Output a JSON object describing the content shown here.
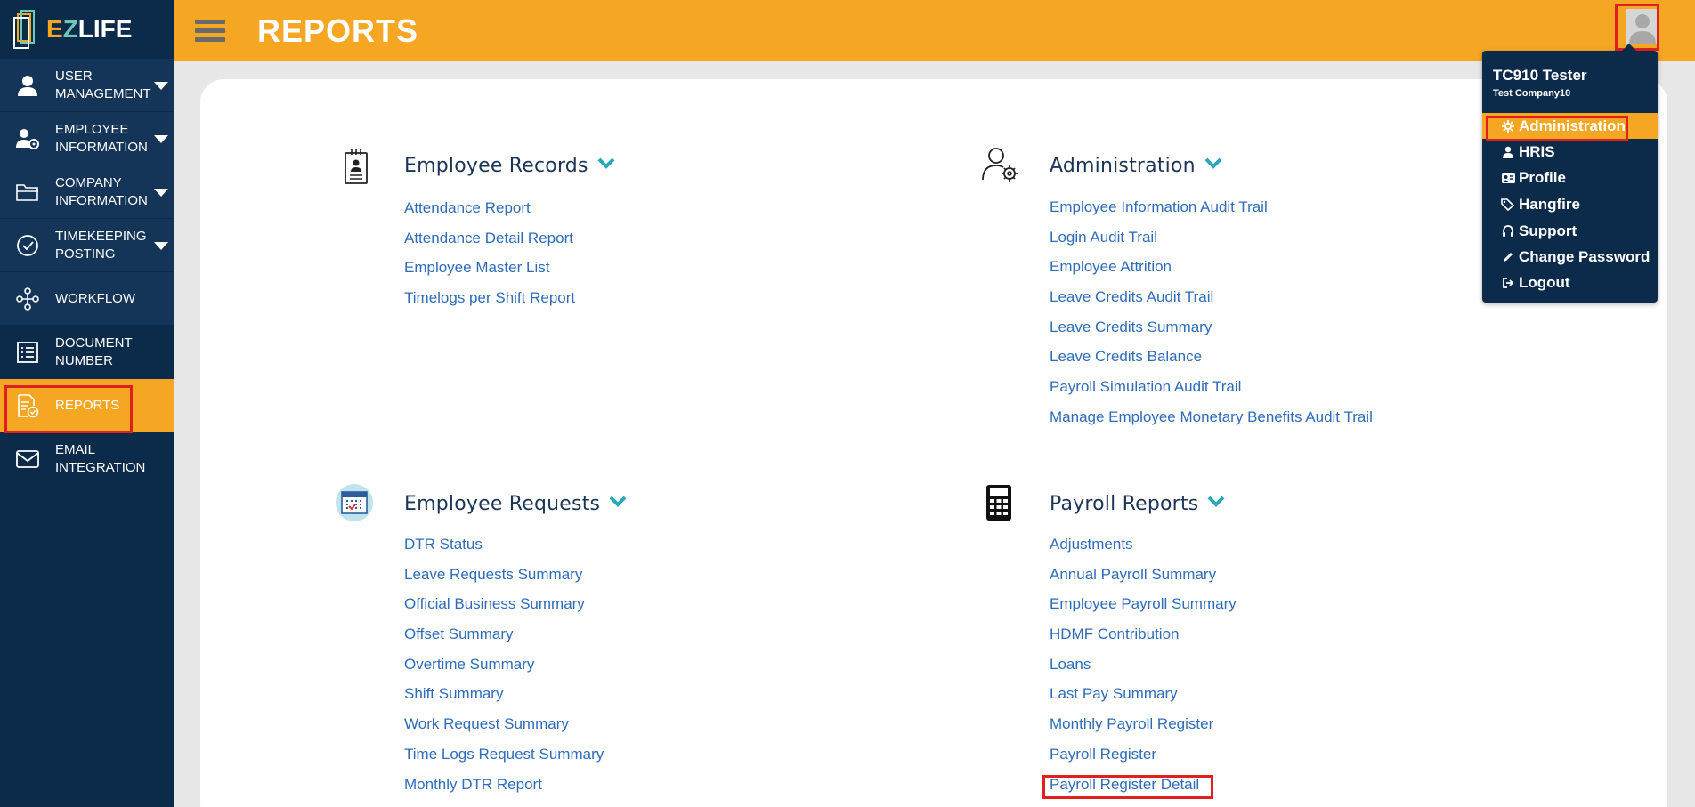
{
  "app": {
    "logo": {
      "e": "E",
      "z": "Z",
      "rest": "LIFE"
    },
    "page_title": "REPORTS"
  },
  "sidebar": {
    "items": [
      {
        "label_line1": "USER",
        "label_line2": "MANAGEMENT",
        "icon": "user-icon"
      },
      {
        "label_line1": "EMPLOYEE",
        "label_line2": "INFORMATION",
        "icon": "employee-settings-icon"
      },
      {
        "label_line1": "COMPANY",
        "label_line2": "INFORMATION",
        "icon": "folder-icon"
      },
      {
        "label_line1": "TIMEKEEPING",
        "label_line2": "POSTING",
        "icon": "check-circle-icon"
      },
      {
        "label_line1": "WORKFLOW",
        "label_line2": "",
        "icon": "workflow-icon"
      },
      {
        "label_line1": "DOCUMENT",
        "label_line2": "NUMBER",
        "icon": "list-icon"
      },
      {
        "label_line1": "REPORTS",
        "label_line2": "",
        "icon": "report-icon"
      },
      {
        "label_line1": "EMAIL",
        "label_line2": "INTEGRATION",
        "icon": "envelope-icon"
      }
    ]
  },
  "sections": {
    "employee_records": {
      "title": "Employee Records",
      "links": [
        "Attendance Report",
        "Attendance Detail Report",
        "Employee Master List",
        "Timelogs per Shift Report"
      ]
    },
    "administration": {
      "title": "Administration",
      "links": [
        "Employee Information Audit Trail",
        "Login Audit Trail",
        "Employee Attrition",
        "Leave Credits Audit Trail",
        "Leave Credits Summary",
        "Leave Credits Balance",
        "Payroll Simulation Audit Trail",
        "Manage Employee Monetary Benefits Audit Trail"
      ]
    },
    "employee_requests": {
      "title": "Employee Requests",
      "links": [
        "DTR Status",
        "Leave Requests Summary",
        "Official Business Summary",
        "Offset Summary",
        "Overtime Summary",
        "Shift Summary",
        "Work Request Summary",
        "Time Logs Request Summary",
        "Monthly DTR Report"
      ]
    },
    "payroll_reports": {
      "title": "Payroll Reports",
      "links": [
        "Adjustments",
        "Annual Payroll Summary",
        "Employee Payroll Summary",
        "HDMF Contribution",
        "Loans",
        "Last Pay Summary",
        "Monthly Payroll Register",
        "Payroll Register",
        "Payroll Register Detail"
      ]
    }
  },
  "user_menu": {
    "user_name": "TC910 Tester",
    "company": "Test Company10",
    "items": [
      {
        "label": "Administration",
        "icon": "gear-icon"
      },
      {
        "label": "HRIS",
        "icon": "user-icon"
      },
      {
        "label": "Profile",
        "icon": "id-card-icon"
      },
      {
        "label": "Hangfire",
        "icon": "tags-icon"
      },
      {
        "label": "Support",
        "icon": "headset-icon"
      },
      {
        "label": "Change Password",
        "icon": "pencil-icon"
      },
      {
        "label": "Logout",
        "icon": "logout-icon"
      }
    ]
  },
  "colors": {
    "sidebar": "#0c2a4a",
    "accent": "#f5a623",
    "link": "#2f6cb8",
    "highlight": "#e02020"
  }
}
